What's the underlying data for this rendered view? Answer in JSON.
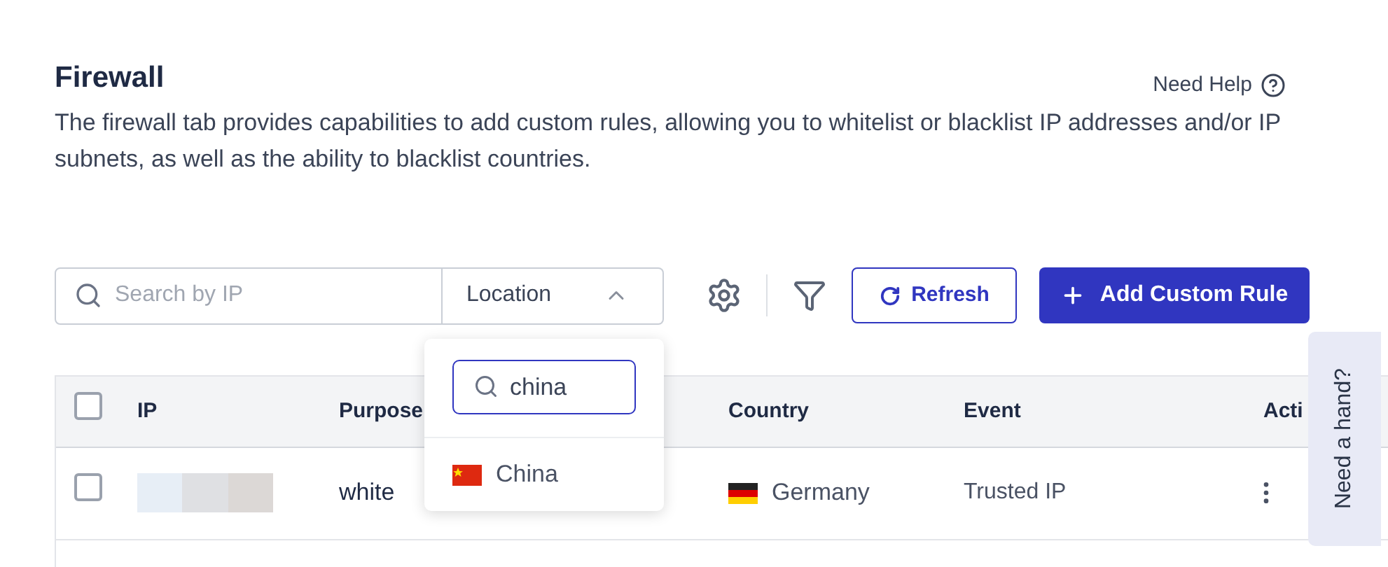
{
  "header": {
    "title": "Firewall",
    "help_link": "Need Help",
    "description": "The firewall tab provides capabilities to add custom rules, allowing you to whitelist or blacklist IP addresses and/or IP subnets, as well as the ability to blacklist countries."
  },
  "toolbar": {
    "search": {
      "placeholder": "Search by IP"
    },
    "location": {
      "label": "Location",
      "expanded": true
    },
    "refresh": "Refresh",
    "add": "Add Custom Rule"
  },
  "location_dropdown": {
    "search_value": "china",
    "options": [
      {
        "label": "China",
        "kind": "cn"
      }
    ]
  },
  "table": {
    "columns": [
      "IP",
      "Purpose",
      "Country",
      "Event",
      "Acti"
    ],
    "header_checked": false,
    "rows": [
      {
        "checked": false,
        "purpose": "white",
        "country": "Germany",
        "kind": "de",
        "event": "Trusted IP"
      }
    ]
  },
  "help_tab": "Need a hand?"
}
